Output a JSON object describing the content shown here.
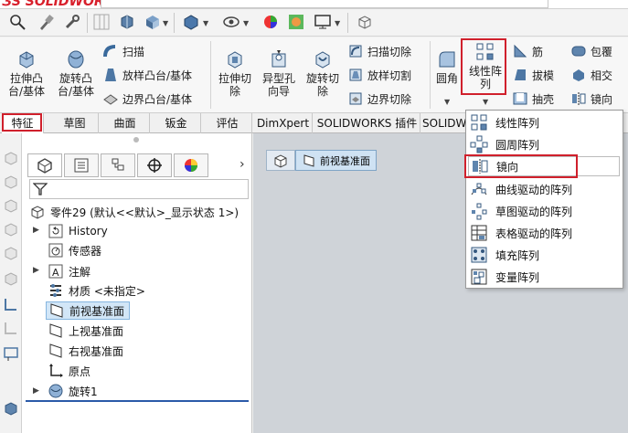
{
  "app": {
    "logo_text": "SOLIDWORKS"
  },
  "ribbon": {
    "extrude_boss": "拉伸凸\n台/基体",
    "revolve_boss": "旋转凸\n台/基体",
    "sweep": "扫描",
    "loft_boss": "放样凸台/基体",
    "boundary_boss": "边界凸台/基体",
    "extrude_cut": "拉伸切\n除",
    "hole_wizard": "异型孔\n向导",
    "revolve_cut": "旋转切\n除",
    "sweep_cut": "扫描切除",
    "loft_cut": "放样切割",
    "boundary_cut": "边界切除",
    "fillet": "圆角",
    "linear_pattern": "线性阵\n列",
    "rib": "筋",
    "draft": "拔模",
    "shell": "抽壳",
    "wrap": "包覆",
    "intersect": "相交",
    "mirror": "镜向"
  },
  "tabs": [
    {
      "label": "特征"
    },
    {
      "label": "草图"
    },
    {
      "label": "曲面"
    },
    {
      "label": "钣金"
    },
    {
      "label": "评估"
    },
    {
      "label": "DimXpert"
    },
    {
      "label": "SOLIDWORKS 插件"
    },
    {
      "label": "SOLIDW"
    }
  ],
  "tree": {
    "root": "零件29 (默认<<默认>_显示状态 1>)",
    "items": [
      {
        "label": "History"
      },
      {
        "label": "传感器"
      },
      {
        "label": "注解"
      },
      {
        "label": "材质 <未指定>"
      },
      {
        "label": "前视基准面"
      },
      {
        "label": "上视基准面"
      },
      {
        "label": "右视基准面"
      },
      {
        "label": "原点"
      },
      {
        "label": "旋转1"
      }
    ]
  },
  "breadcrumb": {
    "current": "前视基准面"
  },
  "dropdown": {
    "items": [
      {
        "label": "线性阵列"
      },
      {
        "label": "圆周阵列"
      },
      {
        "label": "镜向"
      },
      {
        "label": "曲线驱动的阵列"
      },
      {
        "label": "草图驱动的阵列"
      },
      {
        "label": "表格驱动的阵列"
      },
      {
        "label": "填充阵列"
      },
      {
        "label": "变量阵列"
      }
    ]
  },
  "colors": {
    "highlight_red": "#d0202c",
    "selection_blue": "#d2e6f7",
    "canvas": "#cfd3d8"
  }
}
